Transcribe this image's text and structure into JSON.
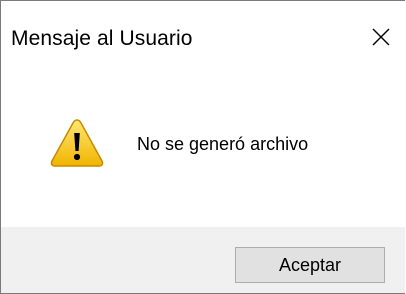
{
  "window": {
    "title": "Mensaje al Usuario"
  },
  "message": {
    "text": "No se generó archivo",
    "icon": "warning-icon"
  },
  "buttons": {
    "ok_label": "Aceptar"
  },
  "colors": {
    "footer_background": "#f0f0f0",
    "button_background": "#e1e1e1",
    "button_border": "#adadad",
    "warning_yellow": "#f4c20d"
  }
}
